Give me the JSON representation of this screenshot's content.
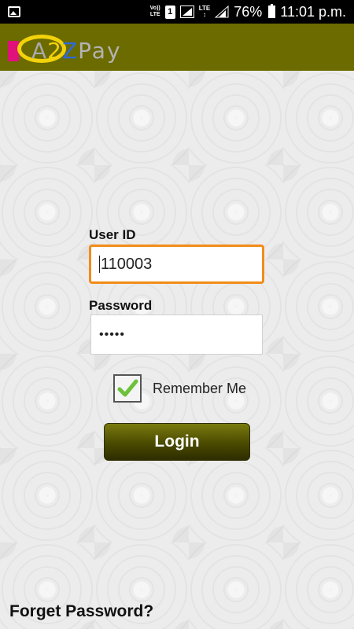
{
  "status_bar": {
    "volte_label": "Vo))\nLTE",
    "sim_number": "1",
    "lte_label": "LTE",
    "battery_percent": "76%",
    "time": "11:01 p.m."
  },
  "header": {
    "logo_text_a": "A",
    "logo_text_2": "2",
    "logo_text_z": "Z",
    "logo_text_pay": "Pay",
    "background_color": "#6b6b00"
  },
  "form": {
    "user_id_label": "User ID",
    "user_id_value": "110003",
    "password_label": "Password",
    "password_value": "•••••",
    "remember_label": "Remember Me",
    "remember_checked": true,
    "login_label": "Login",
    "focus_color": "#f28c1a"
  },
  "footer": {
    "forget_label": "Forget Password?"
  }
}
